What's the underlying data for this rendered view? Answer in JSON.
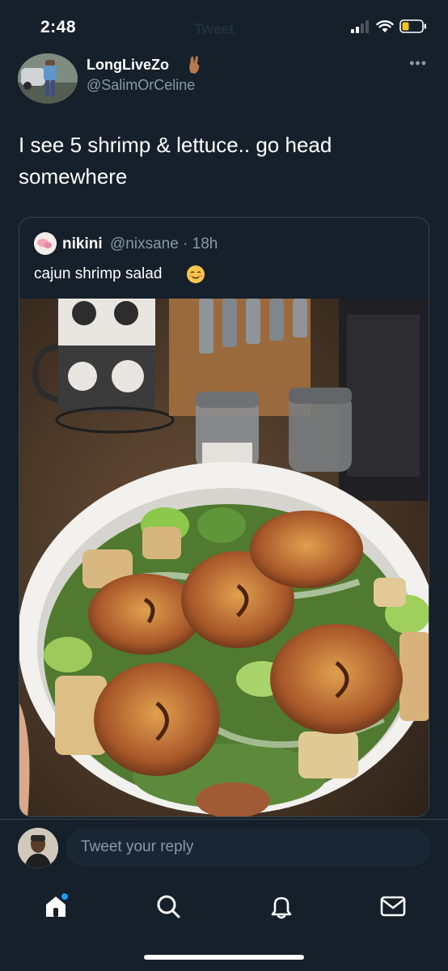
{
  "status_bar": {
    "time": "2:48",
    "ghost_title": "Tweet",
    "icons": [
      "signal-icon",
      "wifi-icon",
      "battery-icon"
    ],
    "battery_color": "#f7c31a"
  },
  "tweet": {
    "author_name": "LongLiveZo",
    "author_emoji_icon": "fingers-crossed-icon",
    "author_handle": "@SalimOrCeline",
    "more_label": "•••",
    "text": "I see 5 shrimp & lettuce.. go head somewhere"
  },
  "quote": {
    "name": "nikini",
    "meta": "@nixsane · 18h",
    "text": "cajun shrimp salad",
    "emoji_icon": "relieved-face-icon",
    "image_icon": "cajun-shrimp-salad-photo"
  },
  "reply": {
    "placeholder": "Tweet your reply"
  },
  "tabs": [
    {
      "name": "home",
      "icon": "home-icon",
      "has_notification_dot": true
    },
    {
      "name": "search",
      "icon": "search-icon"
    },
    {
      "name": "notifications",
      "icon": "bell-icon"
    },
    {
      "name": "messages",
      "icon": "mail-icon"
    }
  ],
  "colors": {
    "background": "#15202b",
    "border": "#38444d",
    "secondary_text": "#8899a6",
    "accent": "#1d9bf0"
  }
}
